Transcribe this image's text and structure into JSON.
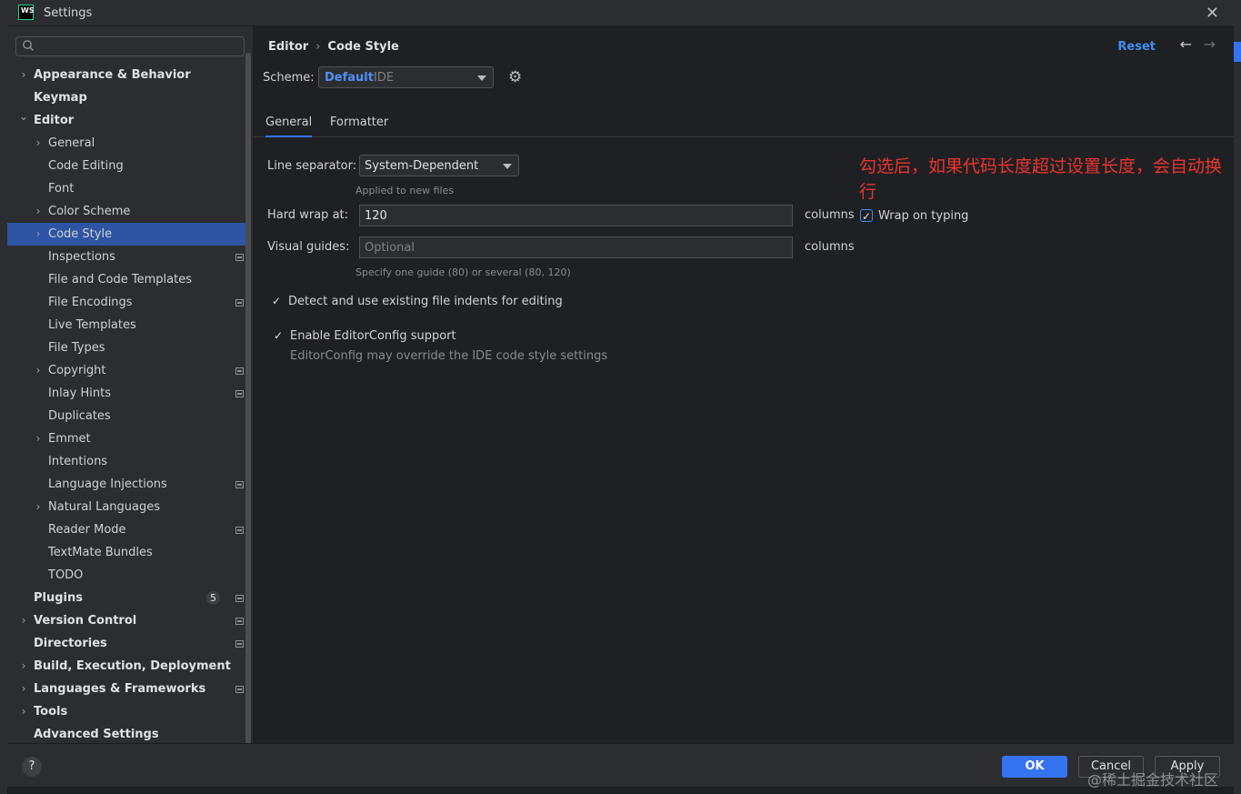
{
  "window": {
    "title": "Settings",
    "app_logo_text": "WS"
  },
  "search": {
    "placeholder": ""
  },
  "sidebar": {
    "items": [
      {
        "label": "Appearance & Behavior",
        "level": 0,
        "expandable": true,
        "expanded": false,
        "project_icon": false
      },
      {
        "label": "Keymap",
        "level": 0,
        "expandable": false,
        "project_icon": false
      },
      {
        "label": "Editor",
        "level": 0,
        "expandable": true,
        "expanded": true,
        "project_icon": false
      },
      {
        "label": "General",
        "level": 1,
        "expandable": true,
        "expanded": false,
        "project_icon": false
      },
      {
        "label": "Code Editing",
        "level": 1,
        "expandable": false,
        "project_icon": false
      },
      {
        "label": "Font",
        "level": 1,
        "expandable": false,
        "project_icon": false
      },
      {
        "label": "Color Scheme",
        "level": 1,
        "expandable": true,
        "expanded": false,
        "project_icon": false
      },
      {
        "label": "Code Style",
        "level": 1,
        "expandable": true,
        "expanded": false,
        "selected": true,
        "project_icon": false
      },
      {
        "label": "Inspections",
        "level": 1,
        "expandable": false,
        "project_icon": true
      },
      {
        "label": "File and Code Templates",
        "level": 1,
        "expandable": false,
        "project_icon": false
      },
      {
        "label": "File Encodings",
        "level": 1,
        "expandable": false,
        "project_icon": true
      },
      {
        "label": "Live Templates",
        "level": 1,
        "expandable": false,
        "project_icon": false
      },
      {
        "label": "File Types",
        "level": 1,
        "expandable": false,
        "project_icon": false
      },
      {
        "label": "Copyright",
        "level": 1,
        "expandable": true,
        "expanded": false,
        "project_icon": true
      },
      {
        "label": "Inlay Hints",
        "level": 1,
        "expandable": false,
        "project_icon": true
      },
      {
        "label": "Duplicates",
        "level": 1,
        "expandable": false,
        "project_icon": false
      },
      {
        "label": "Emmet",
        "level": 1,
        "expandable": true,
        "expanded": false,
        "project_icon": false
      },
      {
        "label": "Intentions",
        "level": 1,
        "expandable": false,
        "project_icon": false
      },
      {
        "label": "Language Injections",
        "level": 1,
        "expandable": false,
        "project_icon": true
      },
      {
        "label": "Natural Languages",
        "level": 1,
        "expandable": true,
        "expanded": false,
        "project_icon": false
      },
      {
        "label": "Reader Mode",
        "level": 1,
        "expandable": false,
        "project_icon": true
      },
      {
        "label": "TextMate Bundles",
        "level": 1,
        "expandable": false,
        "project_icon": false
      },
      {
        "label": "TODO",
        "level": 1,
        "expandable": false,
        "project_icon": false
      },
      {
        "label": "Plugins",
        "level": 0,
        "expandable": false,
        "project_icon": true,
        "badge": "5"
      },
      {
        "label": "Version Control",
        "level": 0,
        "expandable": true,
        "expanded": false,
        "project_icon": true
      },
      {
        "label": "Directories",
        "level": 0,
        "expandable": false,
        "project_icon": true
      },
      {
        "label": "Build, Execution, Deployment",
        "level": 0,
        "expandable": true,
        "expanded": false,
        "project_icon": false
      },
      {
        "label": "Languages & Frameworks",
        "level": 0,
        "expandable": true,
        "expanded": false,
        "project_icon": true
      },
      {
        "label": "Tools",
        "level": 0,
        "expandable": true,
        "expanded": false,
        "project_icon": false
      },
      {
        "label": "Advanced Settings",
        "level": 0,
        "expandable": false,
        "project_icon": false
      }
    ]
  },
  "header": {
    "breadcrumb_parent": "Editor",
    "breadcrumb_separator": "›",
    "breadcrumb_current": "Code Style",
    "reset_label": "Reset"
  },
  "scheme": {
    "label": "Scheme:",
    "name": "Default",
    "sub": "IDE"
  },
  "tabs": [
    {
      "label": "General",
      "active": true
    },
    {
      "label": "Formatter",
      "active": false
    }
  ],
  "general": {
    "line_separator_label": "Line separator:",
    "line_separator_value": "System-Dependent",
    "line_separator_hint": "Applied to new files",
    "hard_wrap_label": "Hard wrap at:",
    "hard_wrap_value": "120",
    "hard_wrap_unit": "columns",
    "wrap_on_typing_label": "Wrap on typing",
    "wrap_on_typing_checked": true,
    "visual_guides_label": "Visual guides:",
    "visual_guides_placeholder": "Optional",
    "visual_guides_unit": "columns",
    "visual_guides_hint": "Specify one guide (80) or several (80, 120)",
    "detect_indents_label": "Detect and use existing file indents for editing",
    "detect_indents_checked": true,
    "editorconfig_label": "Enable EditorConfig support",
    "editorconfig_checked": true,
    "editorconfig_hint": "EditorConfig may override the IDE code style settings"
  },
  "annotation": {
    "text": "勾选后，如果代码长度超过设置长度，会自动换行",
    "color": "#e8342e"
  },
  "footer": {
    "help_label": "?",
    "ok_label": "OK",
    "cancel_label": "Cancel",
    "apply_label": "Apply"
  },
  "watermark": "@稀土掘金技术社区",
  "colors": {
    "accent": "#3574f0",
    "selection": "#2e55a3",
    "link": "#3d8ef0"
  }
}
